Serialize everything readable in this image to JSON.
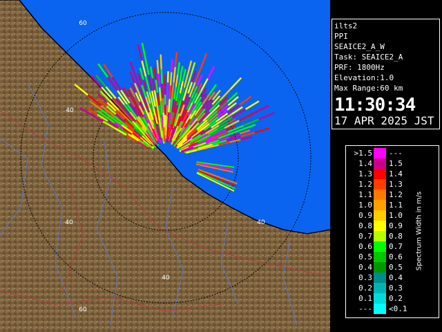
{
  "info": {
    "radar": "ilts2",
    "scan_type": "PPI",
    "scan_name": "SEAICE2_A_W",
    "task": "Task: SEAICE2_A",
    "prf": "PRF: 1800Hz",
    "elevation": "Elevation:1.0",
    "max_range": "Max Range:60 km",
    "time": "11:30:34",
    "date": "17 APR 2025 JST"
  },
  "map": {
    "range_labels": [
      "60",
      "40",
      "40",
      "40",
      "40",
      "60"
    ]
  },
  "legend": {
    "title": "Spectrum Width in m/s",
    "rows": [
      {
        "left": ">1.5",
        "right": "---",
        "color": "#ff00ff"
      },
      {
        "left": "1.4",
        "right": "1.5",
        "color": "#c8008c"
      },
      {
        "left": "1.3",
        "right": "1.4",
        "color": "#ff0000"
      },
      {
        "left": "1.2",
        "right": "1.3",
        "color": "#ff3c00"
      },
      {
        "left": "1.1",
        "right": "1.2",
        "color": "#ff7800"
      },
      {
        "left": "1.0",
        "right": "1.1",
        "color": "#ffa000"
      },
      {
        "left": "0.9",
        "right": "1.0",
        "color": "#ffcc00"
      },
      {
        "left": "0.8",
        "right": "0.9",
        "color": "#ffff00"
      },
      {
        "left": "0.7",
        "right": "0.8",
        "color": "#b4ff00"
      },
      {
        "left": "0.6",
        "right": "0.7",
        "color": "#00ff00"
      },
      {
        "left": "0.5",
        "right": "0.6",
        "color": "#00c800"
      },
      {
        "left": "0.4",
        "right": "0.5",
        "color": "#009600"
      },
      {
        "left": "0.3",
        "right": "0.4",
        "color": "#008c8c"
      },
      {
        "left": "0.2",
        "right": "0.3",
        "color": "#00b4b4"
      },
      {
        "left": "0.1",
        "right": "0.2",
        "color": "#00dcdc"
      },
      {
        "left": "---",
        "right": "<0.1",
        "color": "#00ffff"
      }
    ]
  },
  "colors": {
    "sea": "#0a64f0",
    "land": "#7a5f3c",
    "land_light": "#9a7d55",
    "river": "#5a78c8",
    "border": "#b43c3c",
    "coast": "#000000",
    "range_ring": "#000000"
  }
}
